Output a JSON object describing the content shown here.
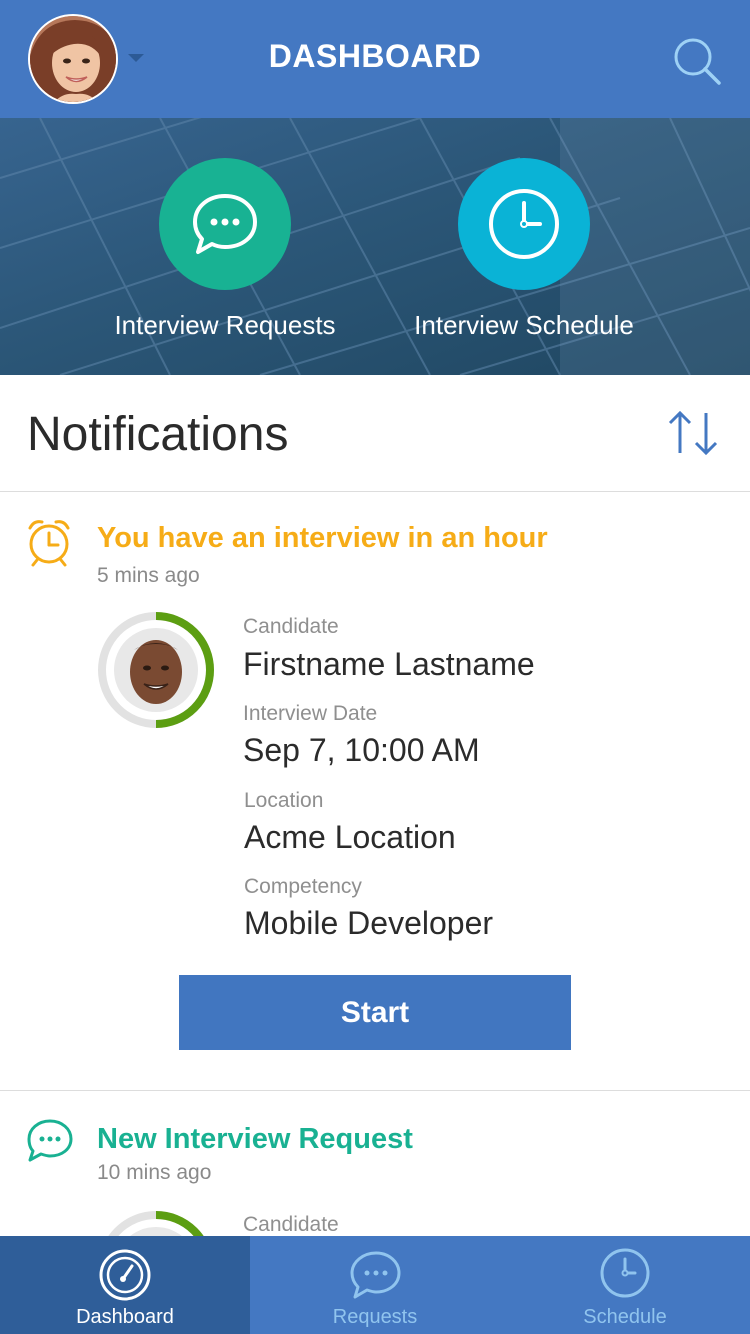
{
  "header": {
    "title": "DASHBOARD",
    "avatar_icon": "user-avatar-woman",
    "dropdown_icon": "caret-down-icon",
    "search_icon": "search-icon"
  },
  "quick_actions": [
    {
      "label": "Interview Requests",
      "icon": "chat-bubble-icon",
      "color": "#18b293"
    },
    {
      "label": "Interview Schedule",
      "icon": "clock-icon",
      "color": "#0ab3d6"
    }
  ],
  "notifications": {
    "title": "Notifications",
    "sort_icon": "sort-arrows-icon",
    "items": [
      {
        "title": "You have an interview in an hour",
        "time": "5 mins ago",
        "icon": "alarm-clock-icon",
        "color": "#f6ac17",
        "progress": 0.5,
        "fields": [
          {
            "label": "Candidate",
            "value": "Firstname Lastname"
          },
          {
            "label": "Interview Date",
            "value": "Sep 7,  10:00 AM"
          },
          {
            "label": "Location",
            "value": "Acme Location"
          },
          {
            "label": "Competency",
            "value": "Mobile Developer"
          }
        ],
        "action_label": "Start"
      },
      {
        "title": "New Interview Request",
        "time": "10 mins ago",
        "icon": "chat-bubble-icon",
        "color": "#19b192",
        "fields": [
          {
            "label": "Candidate"
          }
        ]
      }
    ]
  },
  "tabbar": {
    "active": "Dashboard",
    "tabs": [
      {
        "label": "Dashboard",
        "icon": "speedometer-icon"
      },
      {
        "label": "Requests",
        "icon": "chat-bubble-icon"
      },
      {
        "label": "Schedule",
        "icon": "clock-icon"
      }
    ]
  },
  "colors": {
    "primary": "#4478c2",
    "accent_green": "#5c9e12",
    "alert_orange": "#f6ac17",
    "teal": "#19b192"
  }
}
